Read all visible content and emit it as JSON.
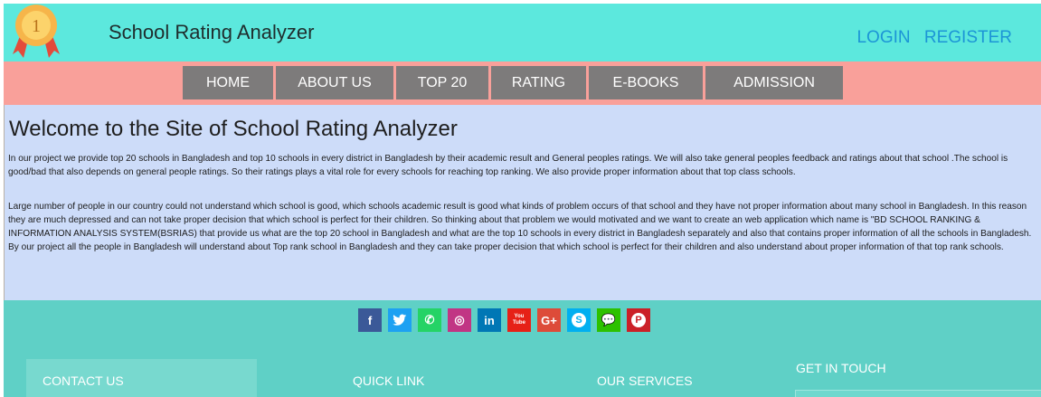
{
  "header": {
    "medal_number": "1",
    "title": "School Rating Analyzer",
    "login": "LOGIN",
    "register": "REGISTER"
  },
  "nav": [
    "HOME",
    "ABOUT US",
    "TOP 20",
    "RATING",
    "E-BOOKS",
    "ADMISSION"
  ],
  "content": {
    "heading": "Welcome to the Site of School Rating Analyzer",
    "p1": "In our project we provide top 20 schools in Bangladesh and top 10 schools in every district in Bangladesh by their academic result and General peoples ratings. We will also take general peoples feedback and ratings about that school .The school is good/bad that also depends on general people ratings. So their ratings plays a vital role for every schools for reaching top ranking. We also provide proper information about that top class schools.",
    "p2": "Large number of people in our country could not understand which school is good, which schools academic result is good what kinds of problem occurs of that school and they have not proper information about many school in Bangladesh. In this reason they are much depressed and can not take proper decision that which school is perfect for their children. So thinking about that problem we would motivated and we want to create an web application which name is \"BD SCHOOL RANKING & INFORMATION ANALYSIS SYSTEM(BSRIAS) that provide us what are the top 20 school in Bangladesh and what are the top 10 schools in every district in Bangladesh separately and also that contains proper information of all the schools in Bangladesh.",
    "p3": "By our project all the people in Bangladesh will understand about Top rank school in Bangladesh and they can take proper decision that which school is perfect for their children and also understand about proper information of that top rank schools."
  },
  "social": [
    {
      "icon": "facebook-icon",
      "glyph": "f",
      "color": "#3b5998"
    },
    {
      "icon": "twitter-icon",
      "glyph": "🐦",
      "color": "#1da1f2"
    },
    {
      "icon": "whatsapp-icon",
      "glyph": "✆",
      "color": "#25d366"
    },
    {
      "icon": "instagram-icon",
      "glyph": "◎",
      "color": "#c13584"
    },
    {
      "icon": "linkedin-icon",
      "glyph": "in",
      "color": "#0077b5"
    },
    {
      "icon": "youtube-icon",
      "glyph": "You Tube",
      "color": "#e62117"
    },
    {
      "icon": "google-plus-icon",
      "glyph": "G+",
      "color": "#dd4b39"
    },
    {
      "icon": "skype-icon",
      "glyph": "S",
      "color": "#00aff0"
    },
    {
      "icon": "wechat-icon",
      "glyph": "💬",
      "color": "#2dc100"
    },
    {
      "icon": "pinterest-icon",
      "glyph": "P",
      "color": "#cb2027"
    }
  ],
  "footer": {
    "contact": "CONTACT US",
    "quick_link": "QUICK LINK",
    "services": "OUR SERVICES",
    "get_in_touch": "GET IN TOUCH"
  }
}
